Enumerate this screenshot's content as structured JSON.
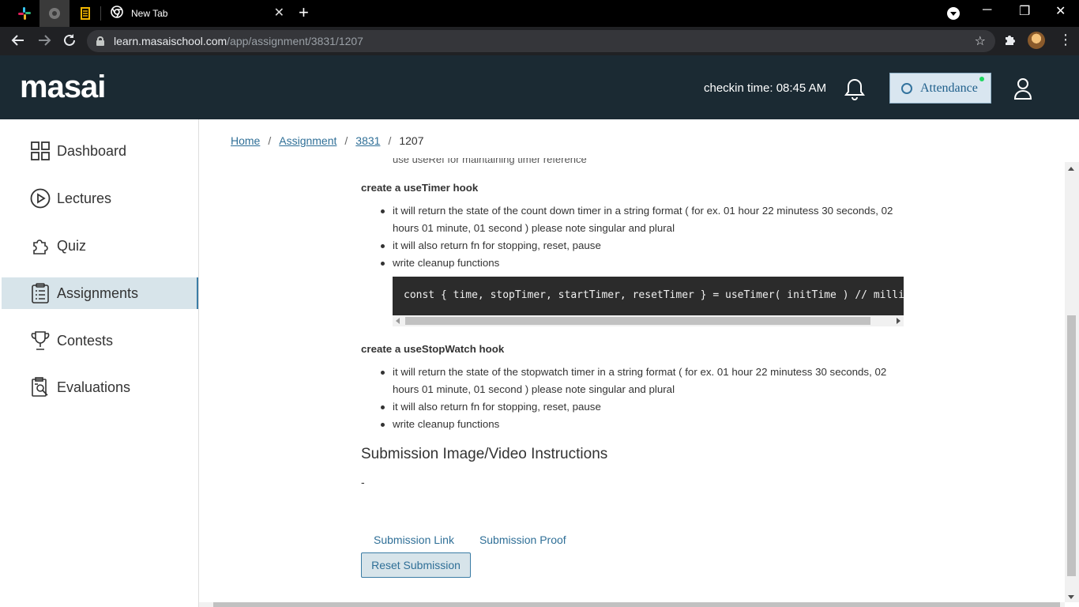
{
  "browser": {
    "tab_title": "New Tab",
    "url_host": "learn.masaischool.com",
    "url_path": "/app/assignment/3831/1207"
  },
  "header": {
    "logo": "masai",
    "checkin_text": "checkin time: 08:45 AM",
    "attendance_label": "Attendance",
    "brand_color": "#1b2a33",
    "accent_color": "#e4202a"
  },
  "sidebar": {
    "items": [
      {
        "label": "Dashboard",
        "icon": "grid-icon"
      },
      {
        "label": "Lectures",
        "icon": "play-circle-icon"
      },
      {
        "label": "Quiz",
        "icon": "puzzle-icon"
      },
      {
        "label": "Assignments",
        "icon": "clipboard-list-icon",
        "active": true
      },
      {
        "label": "Contests",
        "icon": "trophy-icon"
      },
      {
        "label": "Evaluations",
        "icon": "report-icon"
      }
    ]
  },
  "breadcrumb": {
    "home": "Home",
    "assignment": "Assignment",
    "id": "3831",
    "current": "1207"
  },
  "content": {
    "cut_line": "use useRef for maintaining timer reference",
    "timer_heading": "create a useTimer hook",
    "timer_bullets": [
      "it will return the state of the count down timer in a string format ( for ex. 01 hour 22 minutess 30 seconds, 02 hours 01 minute, 01 second ) please note singular and plural",
      "it will also return fn for stopping, reset, pause",
      "write cleanup functions"
    ],
    "code": "const { time, stopTimer, startTimer, resetTimer } = useTimer( initTime ) // milliseconds",
    "stopwatch_heading": "create a useStopWatch hook",
    "stopwatch_bullets": [
      "it will return the state of the stopwatch timer in a string format ( for ex. 01 hour 22 minutess 30 seconds, 02 hours 01 minute, 01 second ) please note singular and plural",
      "it will also return fn for stopping, reset, pause",
      "write cleanup functions"
    ],
    "submission_heading": "Submission Image/Video Instructions",
    "submission_text": "-",
    "tab_link": "Submission Link",
    "tab_proof": "Submission Proof",
    "reset_button": "Reset Submission"
  }
}
